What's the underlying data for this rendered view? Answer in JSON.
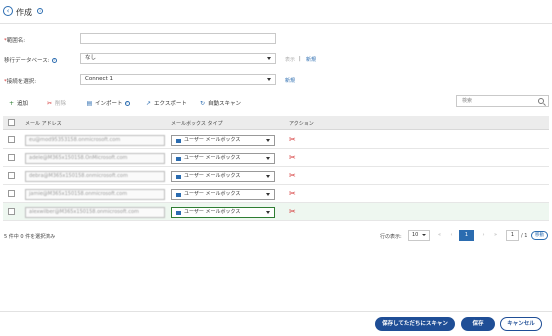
{
  "header": {
    "title": "作成"
  },
  "form": {
    "range_name": {
      "label": "範囲名:",
      "value": ""
    },
    "migration_db": {
      "label": "移行データベース:",
      "value": "なし",
      "link_show": "表示",
      "separator": "|",
      "link_new": "新規"
    },
    "connection": {
      "label": "接続を選択:",
      "value": "Connect 1",
      "link_new": "新規"
    }
  },
  "toolbar": {
    "add": "追加",
    "delete": "削除",
    "import": "インポート",
    "export": "エクスポート",
    "autoscan": "自動スキャン",
    "search_placeholder": "検索"
  },
  "table": {
    "headers": {
      "email": "メール アドレス",
      "mailbox_type": "メールボックス タイプ",
      "action": "アクション"
    },
    "rows": [
      {
        "email": "eu@mod95353158.onmicrosoft.com",
        "type": "ユーザー メールボックス",
        "selected": false
      },
      {
        "email": "adele@M365x150158.OnMicrosoft.com",
        "type": "ユーザー メールボックス",
        "selected": false
      },
      {
        "email": "debra@M365x150158.onmicrosoft.com",
        "type": "ユーザー メールボックス",
        "selected": false
      },
      {
        "email": "jamie@M365x150158.onmicrosoft.com",
        "type": "ユーザー メールボックス",
        "selected": false
      },
      {
        "email": "alexwilber@M365x150158.onmicrosoft.com",
        "type": "ユーザー メールボックス",
        "selected": true
      }
    ]
  },
  "footer": {
    "selection_status": "5 件中 0 件を選択済み",
    "rows_label": "行の表示:",
    "page_size": "10",
    "current_page": "1",
    "page_input": "1",
    "total_pages": "/ 1",
    "go_label": "移動"
  },
  "actions": {
    "save_scan": "保存してただちにスキャン",
    "save": "保存",
    "cancel": "キャンセル"
  },
  "icons": [
    "back-arrow-icon",
    "info-icon",
    "plus-icon",
    "delete-x-icon",
    "import-icon",
    "export-icon",
    "refresh-icon",
    "search-icon",
    "mail-icon",
    "chevron-down-icon"
  ],
  "colors": {
    "accent": "#2b6cb0",
    "primary_button": "#1f4e96",
    "danger": "#d32f2f",
    "selected_row": "#eef7f0"
  }
}
